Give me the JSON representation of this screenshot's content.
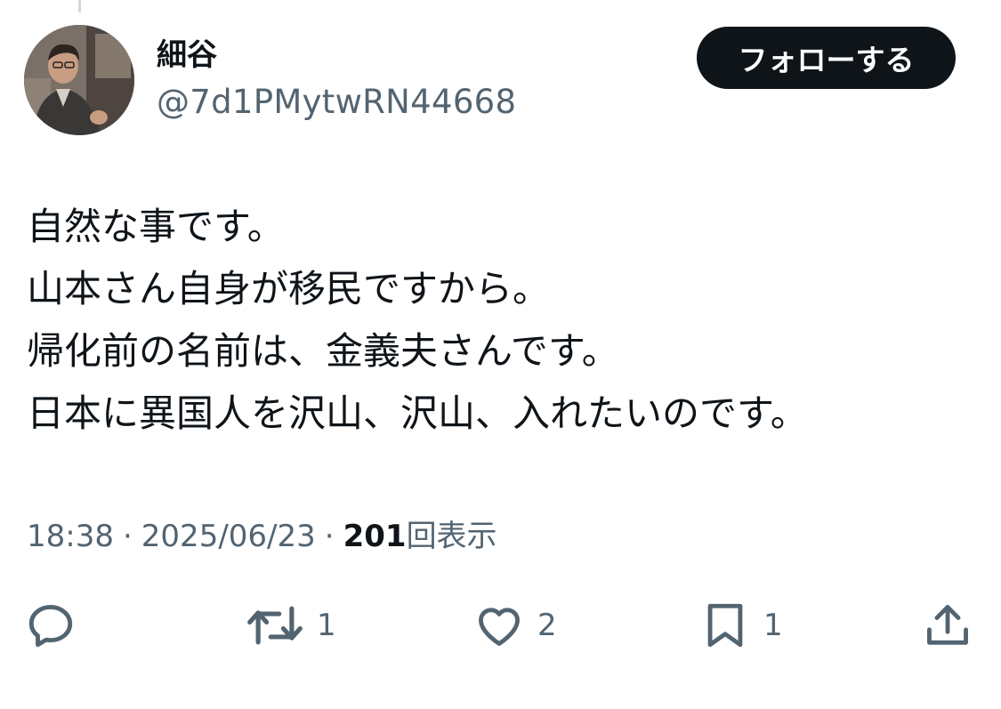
{
  "user": {
    "display_name": "細谷",
    "handle": "@7d1PMytwRN44668"
  },
  "follow_label": "フォローする",
  "tweet": {
    "lines": [
      "自然な事です。",
      "山本さん自身が移民ですから。",
      "帰化前の名前は、金義夫さんです。",
      "日本に異国人を沢山、沢山、入れたいのです。"
    ]
  },
  "meta": {
    "time": "18:38",
    "separator": "·",
    "date": "2025/06/23",
    "views_count": "201",
    "views_label": "回表示"
  },
  "actions": {
    "reply": {
      "icon": "reply-icon",
      "count": ""
    },
    "retweet": {
      "icon": "retweet-icon",
      "count": "1"
    },
    "like": {
      "icon": "heart-icon",
      "count": "2"
    },
    "bookmark": {
      "icon": "bookmark-icon",
      "count": "1"
    },
    "share": {
      "icon": "share-icon",
      "count": ""
    }
  },
  "colors": {
    "text_primary": "#0f1419",
    "text_secondary": "#536471",
    "follow_bg": "#0f1419",
    "follow_text": "#ffffff"
  }
}
